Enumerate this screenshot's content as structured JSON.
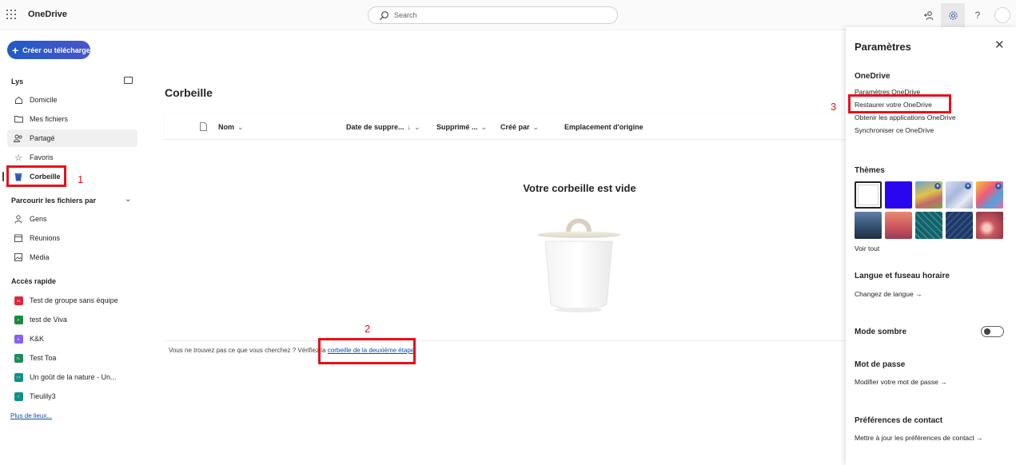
{
  "topbar": {
    "app_name": "OneDrive",
    "search_placeholder": "Search"
  },
  "sidebar": {
    "create_button": "Créer ou télécharger",
    "user_name": "Lys",
    "items": [
      {
        "label": "Domicile",
        "icon": "home-icon"
      },
      {
        "label": "Mes fichiers",
        "icon": "folder-icon"
      },
      {
        "label": "Partagé",
        "icon": "people-icon"
      },
      {
        "label": "Favoris",
        "icon": "star-icon"
      },
      {
        "label": "Corbeille",
        "icon": "trash-icon"
      }
    ],
    "browse_section": "Parcourir les fichiers par",
    "browse_items": [
      {
        "label": "Gens",
        "icon": "person-icon"
      },
      {
        "label": "Réunions",
        "icon": "calendar-icon"
      },
      {
        "label": "Média",
        "icon": "image-icon"
      }
    ],
    "quick_access_title": "Accès rapide",
    "quick_access": [
      {
        "label": "Test de groupe sans équipe",
        "initials": "M",
        "color": "#e0263a"
      },
      {
        "label": "test de Viva",
        "initials": "P",
        "color": "#168a3b"
      },
      {
        "label": "K&K",
        "initials": "K",
        "color": "#8b5cf6"
      },
      {
        "label": "Test Toa",
        "initials": "TL",
        "color": "#1f8a5b"
      },
      {
        "label": "Un goût de la nature - Un...",
        "initials": "TT",
        "color": "#0f8f87"
      },
      {
        "label": "Tieulily3",
        "initials": "T",
        "color": "#0f8f87"
      }
    ],
    "more_places": "Plus de lieux..."
  },
  "main": {
    "title": "Corbeille",
    "columns": [
      "Nom",
      "Date de suppre...",
      "Supprimé ...",
      "Créé par",
      "Emplacement d'origine"
    ],
    "empty_title": "Votre corbeille est vide",
    "hint_text": "Vous ne trouvez pas ce que vous cherchez ? Vérifiez la",
    "hint_link": "corbeille de la deuxième étape"
  },
  "annotations": {
    "label1": "1",
    "label2": "2",
    "label3": "3",
    "color": "#e8101a"
  },
  "settings": {
    "title": "Paramètres",
    "onedrive_heading": "OneDrive",
    "onedrive_links": [
      "Paramètres OneDrive",
      "Restaurer votre OneDrive",
      "Obtenir les applications OneDrive",
      "Synchroniser ce OneDrive"
    ],
    "themes_heading": "Thèmes",
    "themes_see_all": "Voir tout",
    "language_heading": "Langue et fuseau horaire",
    "language_link": "Changez de langue →",
    "dark_mode_label": "Mode sombre",
    "dark_mode_on": false,
    "password_heading": "Mot de passe",
    "password_link": "Modifier votre mot de passe →",
    "contact_heading": "Préférences de contact",
    "contact_link": "Mettre à jour les préférences de contact →"
  }
}
